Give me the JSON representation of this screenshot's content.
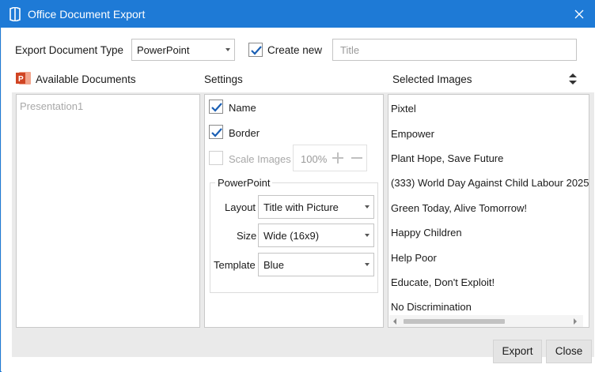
{
  "window": {
    "title": "Office Document Export",
    "app_icon": "office-book-icon",
    "accent_color": "#1e7ad6"
  },
  "top_row": {
    "export_type_label": "Export Document Type",
    "export_type_value": "PowerPoint",
    "create_new_label": "Create new",
    "create_new_checked": true,
    "title_placeholder": "Title",
    "title_value": ""
  },
  "available_documents": {
    "header": "Available Documents",
    "icon": "powerpoint-icon",
    "items": [
      "Presentation1"
    ]
  },
  "settings": {
    "header": "Settings",
    "name_label": "Name",
    "name_checked": true,
    "border_label": "Border",
    "border_checked": true,
    "scale_images_label": "Scale Images",
    "scale_images_checked": false,
    "scale_value": "100%",
    "powerpoint_group": {
      "title": "PowerPoint",
      "layout_label": "Layout",
      "layout_value": "Title with Picture",
      "size_label": "Size",
      "size_value": "Wide (16x9)",
      "template_label": "Template",
      "template_value": "Blue"
    }
  },
  "selected_images": {
    "header": "Selected Images",
    "sort_icon": "sort-updown-icon",
    "items": [
      "Pixtel",
      "Empower",
      "Plant Hope, Save Future",
      "(333) World Day Against Child Labour  2025",
      "Green Today, Alive Tomorrow!",
      "Happy Children",
      "Help Poor",
      "Educate, Don't Exploit!",
      "No Discrimination"
    ]
  },
  "footer": {
    "export_label": "Export",
    "close_label": "Close"
  }
}
